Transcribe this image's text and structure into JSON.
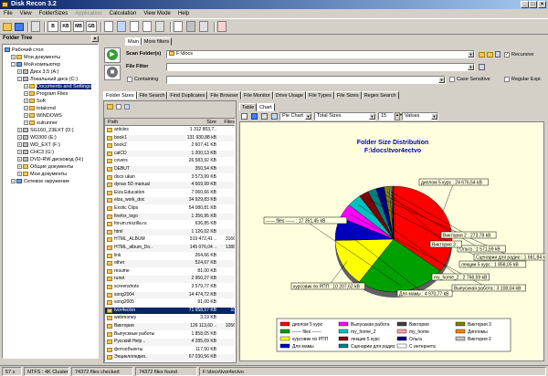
{
  "window": {
    "title": "Disk Recon 3.2"
  },
  "menu": [
    "File",
    "View",
    "FolderSizes",
    "Application",
    "Calculation",
    "View Mode",
    "Help"
  ],
  "toolbar": {
    "btn_b": "B",
    "btn_kb": "KB",
    "btn_mb": "MB",
    "btn_gb": "GB"
  },
  "tree": {
    "title": "Folder Tree",
    "items": [
      {
        "label": "Рабочий стол",
        "level": 0,
        "icon": "desktop",
        "exp": ""
      },
      {
        "label": "Мои документы",
        "level": 1,
        "icon": "folder",
        "exp": "+"
      },
      {
        "label": "Мой компьютер",
        "level": 1,
        "icon": "computer",
        "exp": "-"
      },
      {
        "label": "Диск 3,5 (A:)",
        "level": 2,
        "icon": "drive",
        "exp": "+"
      },
      {
        "label": "Локальный диск (C:)",
        "level": 2,
        "icon": "drive",
        "exp": "-"
      },
      {
        "label": "Documents and Settings",
        "level": 3,
        "icon": "folder",
        "exp": "+",
        "selected": true
      },
      {
        "label": "Program Files",
        "level": 3,
        "icon": "folder",
        "exp": "+"
      },
      {
        "label": "Soft",
        "level": 3,
        "icon": "folder",
        "exp": "+"
      },
      {
        "label": "totalcmd",
        "level": 3,
        "icon": "folder",
        "exp": "+"
      },
      {
        "label": "WINDOWS",
        "level": 3,
        "icon": "folder",
        "exp": "+"
      },
      {
        "label": "xulrunner",
        "level": 3,
        "icon": "folder",
        "exp": "+"
      },
      {
        "label": "SG160_23EXT (D:)",
        "level": 2,
        "icon": "drive",
        "exp": "+"
      },
      {
        "label": "WD300 (E:)",
        "level": 2,
        "icon": "drive",
        "exp": "+"
      },
      {
        "label": "WD_EXT (F:)",
        "level": 2,
        "icon": "drive",
        "exp": "+"
      },
      {
        "label": "CHC3 (G:)",
        "level": 2,
        "icon": "drive",
        "exp": "+"
      },
      {
        "label": "DVD-RW дисковод (H:)",
        "level": 2,
        "icon": "drive",
        "exp": "+"
      },
      {
        "label": "Общие документы",
        "level": 2,
        "icon": "folder",
        "exp": "+"
      },
      {
        "label": "Мои документы",
        "level": 2,
        "icon": "folder",
        "exp": "+"
      },
      {
        "label": "Сетевое окружение",
        "level": 1,
        "icon": "network",
        "exp": "+"
      }
    ]
  },
  "top_tabs": [
    "Main",
    "More filters"
  ],
  "scan": {
    "label": "Scan Folder(s)",
    "value": "F:\\docs",
    "recursive": "Recursive"
  },
  "filter": {
    "label": "File Filter",
    "value": ""
  },
  "containing": {
    "label": "Containing",
    "value": "",
    "case": "Case Sensitive",
    "regex": "Regular Expr."
  },
  "main_tabs": [
    "Folder Sizes",
    "File Search",
    "Find Duplicates",
    "File Browser",
    "File Monitor",
    "Drive Usage",
    "File Types",
    "File Sizes",
    "Regex Search"
  ],
  "grid": {
    "headers": [
      "Path",
      "Size",
      "Files"
    ],
    "rows": [
      {
        "name": "articles",
        "size": "1 312 803,7..",
        "files": ""
      },
      {
        "name": "book1",
        "size": "131 930,88 kB",
        "files": ""
      },
      {
        "name": "book2",
        "size": "2 607,41 KB",
        "files": ""
      },
      {
        "name": "calCD",
        "size": "1 200,13 KB",
        "files": ""
      },
      {
        "name": "covers",
        "size": "26 583,92 KB",
        "files": ""
      },
      {
        "name": "DEBUT",
        "size": "350,54 KB",
        "files": ""
      },
      {
        "name": "docs ukan",
        "size": "3 573,99 KB",
        "files": ""
      },
      {
        "name": "dynax 5D manual",
        "size": "4 669,99 KB",
        "files": ""
      },
      {
        "name": "Elza Education",
        "size": "7 060,66 KB",
        "files": ""
      },
      {
        "name": "elza_work_doc",
        "size": "34 929,83 KB",
        "files": ""
      },
      {
        "name": "Exotic Clips",
        "size": "54 080,81 KB",
        "files": ""
      },
      {
        "name": "firefox_logo",
        "size": "1 356,95 KB",
        "files": ""
      },
      {
        "name": "forum.mozilla.ru",
        "size": "636,85 KB",
        "files": ""
      },
      {
        "name": "html",
        "size": "1 126,02 KB",
        "files": ""
      },
      {
        "name": "HTML_ALBUM",
        "size": "319 472,41 ..",
        "files": "3166"
      },
      {
        "name": "HTML_album_Do..",
        "size": "145 076,04 ..",
        "files": "1388"
      },
      {
        "name": "link",
        "size": "264,66 KB",
        "files": ""
      },
      {
        "name": "other",
        "size": "524,67 KB",
        "files": ""
      },
      {
        "name": "resume",
        "size": "81,00 KB",
        "files": ""
      },
      {
        "name": "runet",
        "size": "2 950,27 KB",
        "files": ""
      },
      {
        "name": "screenshots",
        "size": "3 579,77 KB",
        "files": ""
      },
      {
        "name": "song2004",
        "size": "14 474,72 KB",
        "files": ""
      },
      {
        "name": "song2005",
        "size": "91,00 KB",
        "files": ""
      },
      {
        "name": "tvor4ectvo",
        "size": "71 658,57 KB",
        "files": "10",
        "selected": true
      },
      {
        "name": "webmoney",
        "size": "3,19 KB",
        "files": ""
      },
      {
        "name": "Виктория",
        "size": "126 113,60 ..",
        "files": "1056"
      },
      {
        "name": "Выпускные работы",
        "size": "1 858,05 KB",
        "files": ""
      },
      {
        "name": "Русский Help ..",
        "size": "4 285,09 KB",
        "files": ""
      },
      {
        "name": "фотообъекты",
        "size": "117,50 KB",
        "files": ""
      },
      {
        "name": "Энциклопедия..",
        "size": "67 030,56 KB",
        "files": ""
      }
    ]
  },
  "chart_tabs": [
    "Table",
    "Chart"
  ],
  "chart_toolbar": {
    "type": "Pie Chart",
    "metric": "Total Sizes",
    "count": "15",
    "mode": "Values"
  },
  "chart_data": {
    "type": "pie",
    "title": "Folder Size Distribution",
    "subtitle": "F:\\docs\\tvor4ectvo",
    "slices": [
      {
        "label": "диплом 5 курс",
        "value": 24676.54,
        "display": "диплом 5 курс : 24 676,54 kB",
        "color": "#ff0000"
      },
      {
        "label": "------ files ------",
        "value": 17351.45,
        "display": "------ files ------ : 17 351,45 kB",
        "color": "#00a000"
      },
      {
        "label": "курсовик по РПП",
        "value": 10207.62,
        "display": "курсовик по РПП : 10 207,62 kB",
        "color": "#ffff00"
      },
      {
        "label": "Для мамы",
        "value": 4970.77,
        "display": "Для мамы : 4 970,77 kB",
        "color": "#0000c0"
      },
      {
        "label": "Выпускная работа",
        "value": 3108.04,
        "display": "Выпускная работа : 3 108,04 kB",
        "color": "#ff00ff"
      },
      {
        "label": "my_home_2",
        "value": 2768.59,
        "display": "my_home_2 : 2 768,59 kB",
        "color": "#00c0c0"
      },
      {
        "label": "лекции 5 курс",
        "value": 1858.05,
        "display": "лекции 5 курс : 1 858,05 kB",
        "color": "#800000"
      },
      {
        "label": "Сценарии для радио",
        "value": 1661.84,
        "display": "Сценарии для радио : 1 661,84 kB",
        "color": "#008080"
      },
      {
        "label": "Ольга",
        "value": 1571.59,
        "display": "Ольга : 1 571,59 kB",
        "color": "#000080"
      },
      {
        "label": "Виктория 3",
        "value": 1000,
        "display": "Виктория 3 :",
        "color": "#808000"
      },
      {
        "label": "Виктория 2",
        "value": 273.78,
        "display": "Виктория 2 : 273,78 kB",
        "color": "#c0c0c0"
      },
      {
        "label": "my_home",
        "value": 200,
        "display": "",
        "color": "#ffa0a0"
      },
      {
        "label": "Дипломы",
        "value": 150,
        "display": "",
        "color": "#ff8000"
      },
      {
        "label": "С интернета",
        "value": 120,
        "display": "",
        "color": "#ffffff"
      },
      {
        "label": "Виктория",
        "value": 100,
        "display": "",
        "color": "#404040"
      }
    ],
    "legend": [
      {
        "label": "диплом 5 курс",
        "color": "#ff0000"
      },
      {
        "label": "------ files ------",
        "color": "#00a000"
      },
      {
        "label": "курсовик по РПП",
        "color": "#ffff00"
      },
      {
        "label": "Для мамы",
        "color": "#0000c0"
      },
      {
        "label": "Выпускная работа",
        "color": "#ff00ff"
      },
      {
        "label": "my_home_2",
        "color": "#00c0c0"
      },
      {
        "label": "лекции 5 курс",
        "color": "#800000"
      },
      {
        "label": "Сценарии для радио",
        "color": "#008080"
      },
      {
        "label": "Виктория",
        "color": "#404040"
      },
      {
        "label": "my_home",
        "color": "#ffa0a0"
      },
      {
        "label": "Ольга",
        "color": "#000080"
      },
      {
        "label": "С интернета",
        "color": "#ffffff"
      },
      {
        "label": "Виктория 3",
        "color": "#808000"
      },
      {
        "label": "Дипломы",
        "color": "#ff8000"
      },
      {
        "label": "Виктория 2",
        "color": "#c0c0c0"
      }
    ]
  },
  "status": {
    "time": "57 s",
    "fs": "NTFS : 4K Cluster",
    "checked": "74372 files checked",
    "found": "74372 files found",
    "path": "F:\\docs\\tvor4ectvo"
  }
}
